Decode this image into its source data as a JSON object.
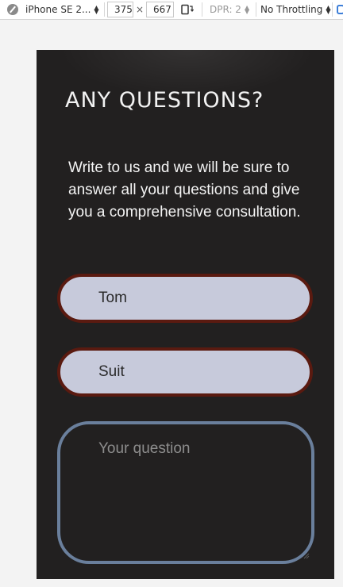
{
  "devtools": {
    "device": "iPhone SE 2...",
    "width": "375",
    "times": "×",
    "height": "667",
    "dpr": "DPR: 2",
    "throttling": "No Throttling",
    "icons": [
      "compass-icon",
      "rotate-icon",
      "sensor-icon"
    ]
  },
  "page": {
    "title": "ANY QUESTIONS?",
    "lead": "Write to us and we will be sure to answer all your questions and give you a comprehensive consultation.",
    "name_value": "Tom",
    "surname_value": "Suit",
    "question_placeholder": "Your question"
  },
  "colors": {
    "page_bg": "#222020",
    "input_bg": "#c7cadb",
    "input_border": "#5a1a10",
    "textarea_border": "#6a7f9c"
  }
}
